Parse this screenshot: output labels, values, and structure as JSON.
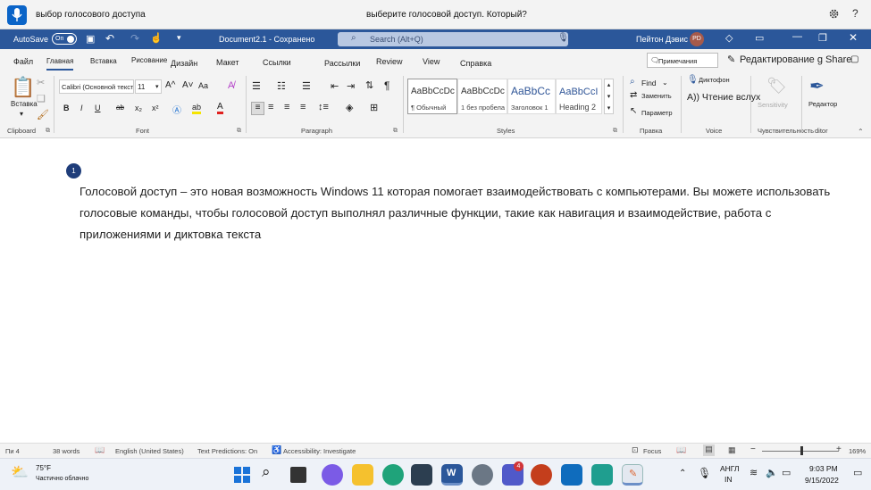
{
  "voice_access": {
    "left_text": "выбор голосового доступа",
    "center_text": "выберите голосовой доступ. Который?"
  },
  "titlebar": {
    "autosave_label": "AutoSave",
    "autosave_state": "On",
    "doc_title": "Document2.1 - Сохранено",
    "search_placeholder": "Search (Alt+Q)",
    "user_name": "Пейтон Дэвис",
    "user_initials": "PD"
  },
  "tabs": {
    "file": "Файл",
    "home": "Главная",
    "insert": "Вставка",
    "draw": "Рисование",
    "design": "Дизайн",
    "layout": "Макет",
    "references": "Ссылки",
    "mailings": "Рассылки",
    "review": "Review",
    "view": "View",
    "help": "Справка",
    "comments": "Примечания",
    "editing": "Редактирование g Share"
  },
  "ribbon": {
    "paste_label": "Вставка",
    "clipboard": "Clipboard",
    "font_group": "Font",
    "paragraph": "Paragraph",
    "styles_group": "Styles",
    "editing_group": "Правка",
    "voice_group": "Voice",
    "sensitivity_group": "Чувствительность",
    "editor_group": "ditor",
    "font_name": "Calibri (Основной текст)",
    "font_size": "11",
    "bold": "B",
    "italic": "I",
    "underline": "U",
    "strike": "ab",
    "sub": "x₂",
    "sup": "x²",
    "grow": "A^",
    "shrink": "A˅",
    "case": "Aa",
    "font_color": "A",
    "highlight": "ab",
    "styles": [
      {
        "preview": "AaBbCcDc",
        "name": "¶ Обычный"
      },
      {
        "preview": "AaBbCcDc",
        "name": "1 без пробела"
      },
      {
        "preview": "AaBbCc",
        "name": "Заголовок 1"
      },
      {
        "preview": "AaBbCcI",
        "name": "Heading 2"
      }
    ],
    "find": "Find",
    "replace": "Заменить",
    "select": "Параметр",
    "dictate": "Диктофон",
    "read_aloud": "А)) Чтение вслух",
    "sensitivity": "Sensitivity",
    "editor": "Редактор"
  },
  "document": {
    "comment_number": "1",
    "paragraph": "Голосовой доступ – это новая возможность Windows 11 которая помогает взаимодействовать с компьютерами. Вы можете использовать голосовые команды, чтобы голосовой доступ выполнял различные функции, такие как навигация и взаимодействие, работа с приложениями и диктовка текста"
  },
  "status": {
    "page": "Пи 4",
    "words": "38 words",
    "language": "English (United States)",
    "predictions": "Text Predictions: On",
    "accessibility": "Accessibility: Investigate",
    "focus": "Focus",
    "zoom": "169%"
  },
  "taskbar": {
    "weather_temp": "75°F",
    "weather_desc": "Частично облачно",
    "lang_top": "АНГЛ",
    "lang_bottom": "IN",
    "time": "9:03 PM",
    "date": "9/15/2022",
    "teams_badge": "4"
  },
  "colors": {
    "word_blue": "#2b579a",
    "voice_blue": "#0a64c8"
  }
}
